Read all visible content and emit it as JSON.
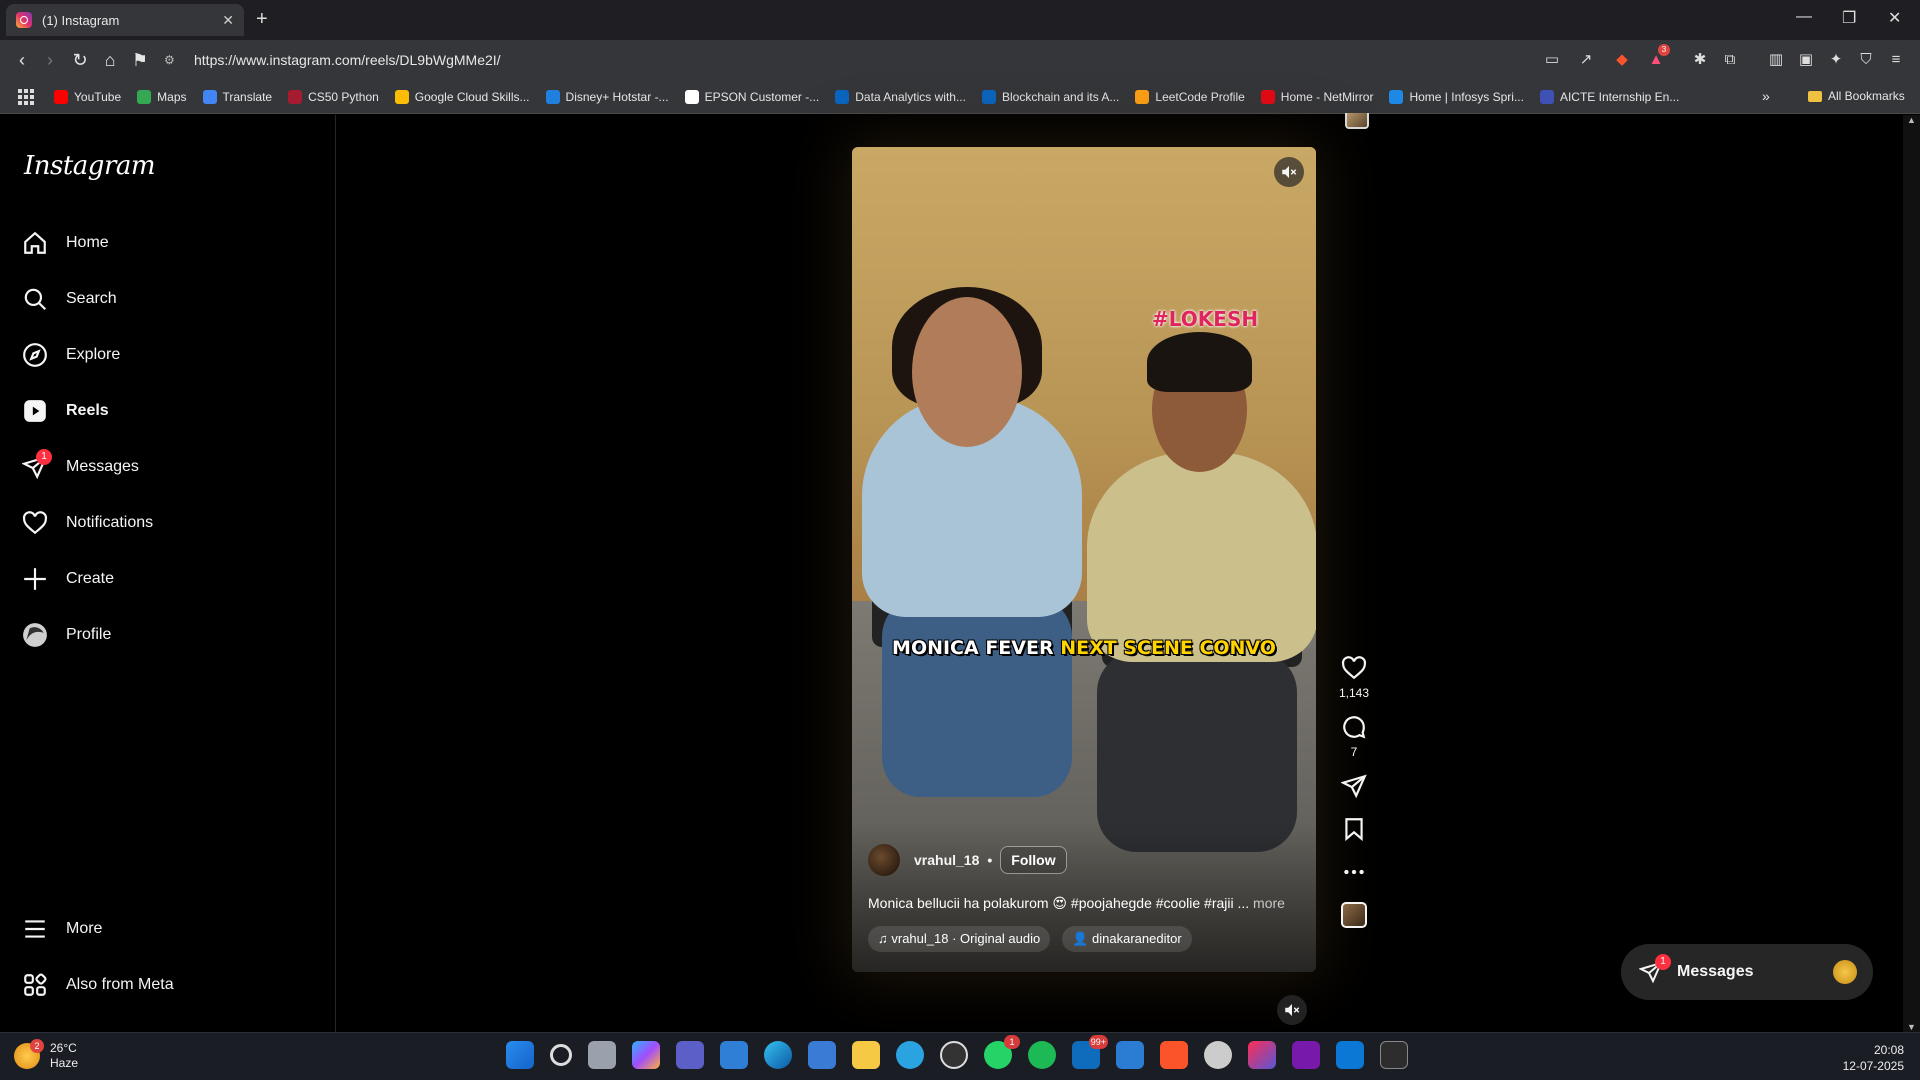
{
  "browser": {
    "tab_title": "(1) Instagram",
    "url": "https://www.instagram.com/reels/DL9bWgMMe2I/",
    "bookmarks": [
      {
        "label": "YouTube",
        "color": "#ff0000"
      },
      {
        "label": "Maps",
        "color": "#34a853"
      },
      {
        "label": "Translate",
        "color": "#4285f4"
      },
      {
        "label": "CS50 Python",
        "color": "#a51c30"
      },
      {
        "label": "Google Cloud Skills...",
        "color": "#fbbc05"
      },
      {
        "label": "Disney+ Hotstar -...",
        "color": "#1f80e0"
      },
      {
        "label": "EPSON Customer -...",
        "color": "#ffffff"
      },
      {
        "label": "Data Analytics with...",
        "color": "#0a66c2"
      },
      {
        "label": "Blockchain and its A...",
        "color": "#0a66c2"
      },
      {
        "label": "LeetCode Profile",
        "color": "#ffa116"
      },
      {
        "label": "Home - NetMirror",
        "color": "#e50914"
      },
      {
        "label": "Home | Infosys Spri...",
        "color": "#1e88e5"
      },
      {
        "label": "AICTE Internship En...",
        "color": "#3f51b5"
      }
    ],
    "all_bookmarks": "All Bookmarks",
    "extension_badge": "3"
  },
  "sidebar": {
    "logo": "Instagram",
    "items": [
      {
        "label": "Home",
        "icon": "home-icon"
      },
      {
        "label": "Search",
        "icon": "search-icon"
      },
      {
        "label": "Explore",
        "icon": "compass-icon"
      },
      {
        "label": "Reels",
        "icon": "reels-icon"
      },
      {
        "label": "Messages",
        "icon": "paper-plane-icon",
        "badge": "1"
      },
      {
        "label": "Notifications",
        "icon": "heart-icon"
      },
      {
        "label": "Create",
        "icon": "plus-icon"
      },
      {
        "label": "Profile",
        "icon": "avatar"
      }
    ],
    "more": "More",
    "also_from_meta": "Also from Meta"
  },
  "reel": {
    "overlay_tag": "#LOKESH",
    "overlay_caption_white": "MONICA FEVER",
    "overlay_caption_yellow": "NEXT SCENE CONVO",
    "author": "vrahul_18",
    "follow": "Follow",
    "separator": "•",
    "description": "Monica bellucii ha polakurom 😍 #poojahegde #coolie #rajii ...",
    "more": "more",
    "audio": "♫ vrahul_18 · Original audio",
    "tagged_user": "dinakaraneditor"
  },
  "actions": {
    "likes": "1,143",
    "comments": "7"
  },
  "messages_pill": {
    "label": "Messages",
    "badge": "1"
  },
  "taskbar": {
    "weather_badge": "2",
    "temperature": "26°C",
    "condition": "Haze",
    "whatsapp_badge": "1",
    "mail_badge": "99+",
    "time": "20:08",
    "date": "12-07-2025"
  }
}
